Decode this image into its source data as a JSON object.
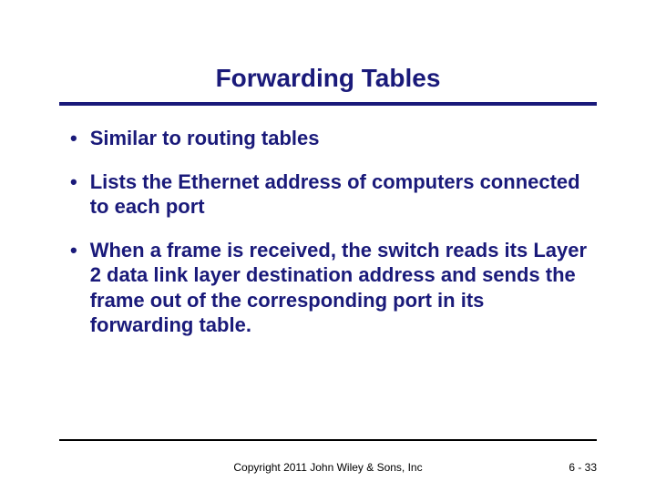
{
  "title": "Forwarding Tables",
  "bullets": [
    "Similar to routing tables",
    "Lists the Ethernet address of computers connected to each port",
    "When a frame is received, the switch reads its Layer 2 data link layer destination address and sends the frame out of the corresponding port in its forwarding table."
  ],
  "footer": {
    "copyright": "Copyright 2011 John Wiley & Sons, Inc",
    "pagenum": "6 - 33"
  }
}
